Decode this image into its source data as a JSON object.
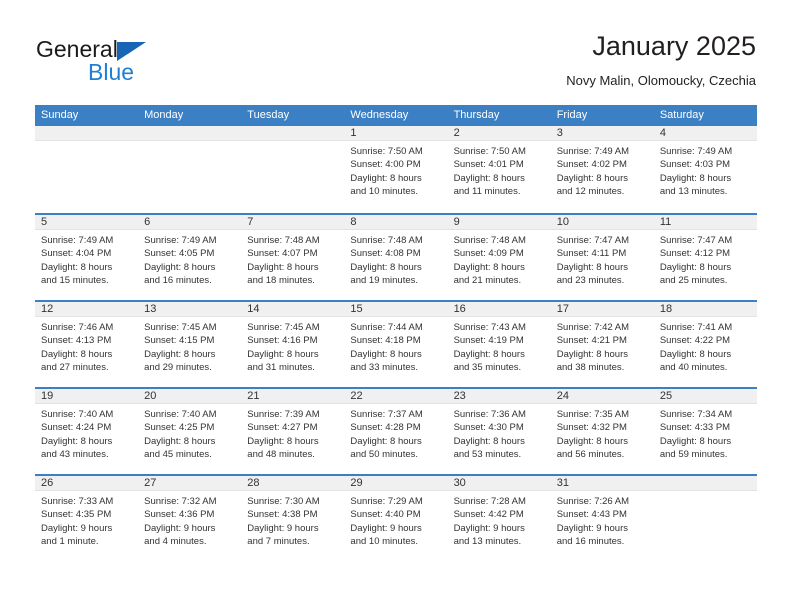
{
  "brand": {
    "name_part1": "General",
    "name_part2": "Blue",
    "triangle_icon": "brand-triangle-icon",
    "accent_color": "#1f7fd4"
  },
  "header": {
    "title": "January 2025",
    "subtitle": "Novy Malin, Olomoucky, Czechia"
  },
  "calendar": {
    "header_color": "#3b7fc4",
    "weekdays": [
      "Sunday",
      "Monday",
      "Tuesday",
      "Wednesday",
      "Thursday",
      "Friday",
      "Saturday"
    ],
    "weeks": [
      [
        {
          "day": "",
          "lines": []
        },
        {
          "day": "",
          "lines": []
        },
        {
          "day": "",
          "lines": []
        },
        {
          "day": "1",
          "lines": [
            "Sunrise: 7:50 AM",
            "Sunset: 4:00 PM",
            "Daylight: 8 hours",
            "and 10 minutes."
          ]
        },
        {
          "day": "2",
          "lines": [
            "Sunrise: 7:50 AM",
            "Sunset: 4:01 PM",
            "Daylight: 8 hours",
            "and 11 minutes."
          ]
        },
        {
          "day": "3",
          "lines": [
            "Sunrise: 7:49 AM",
            "Sunset: 4:02 PM",
            "Daylight: 8 hours",
            "and 12 minutes."
          ]
        },
        {
          "day": "4",
          "lines": [
            "Sunrise: 7:49 AM",
            "Sunset: 4:03 PM",
            "Daylight: 8 hours",
            "and 13 minutes."
          ]
        }
      ],
      [
        {
          "day": "5",
          "lines": [
            "Sunrise: 7:49 AM",
            "Sunset: 4:04 PM",
            "Daylight: 8 hours",
            "and 15 minutes."
          ]
        },
        {
          "day": "6",
          "lines": [
            "Sunrise: 7:49 AM",
            "Sunset: 4:05 PM",
            "Daylight: 8 hours",
            "and 16 minutes."
          ]
        },
        {
          "day": "7",
          "lines": [
            "Sunrise: 7:48 AM",
            "Sunset: 4:07 PM",
            "Daylight: 8 hours",
            "and 18 minutes."
          ]
        },
        {
          "day": "8",
          "lines": [
            "Sunrise: 7:48 AM",
            "Sunset: 4:08 PM",
            "Daylight: 8 hours",
            "and 19 minutes."
          ]
        },
        {
          "day": "9",
          "lines": [
            "Sunrise: 7:48 AM",
            "Sunset: 4:09 PM",
            "Daylight: 8 hours",
            "and 21 minutes."
          ]
        },
        {
          "day": "10",
          "lines": [
            "Sunrise: 7:47 AM",
            "Sunset: 4:11 PM",
            "Daylight: 8 hours",
            "and 23 minutes."
          ]
        },
        {
          "day": "11",
          "lines": [
            "Sunrise: 7:47 AM",
            "Sunset: 4:12 PM",
            "Daylight: 8 hours",
            "and 25 minutes."
          ]
        }
      ],
      [
        {
          "day": "12",
          "lines": [
            "Sunrise: 7:46 AM",
            "Sunset: 4:13 PM",
            "Daylight: 8 hours",
            "and 27 minutes."
          ]
        },
        {
          "day": "13",
          "lines": [
            "Sunrise: 7:45 AM",
            "Sunset: 4:15 PM",
            "Daylight: 8 hours",
            "and 29 minutes."
          ]
        },
        {
          "day": "14",
          "lines": [
            "Sunrise: 7:45 AM",
            "Sunset: 4:16 PM",
            "Daylight: 8 hours",
            "and 31 minutes."
          ]
        },
        {
          "day": "15",
          "lines": [
            "Sunrise: 7:44 AM",
            "Sunset: 4:18 PM",
            "Daylight: 8 hours",
            "and 33 minutes."
          ]
        },
        {
          "day": "16",
          "lines": [
            "Sunrise: 7:43 AM",
            "Sunset: 4:19 PM",
            "Daylight: 8 hours",
            "and 35 minutes."
          ]
        },
        {
          "day": "17",
          "lines": [
            "Sunrise: 7:42 AM",
            "Sunset: 4:21 PM",
            "Daylight: 8 hours",
            "and 38 minutes."
          ]
        },
        {
          "day": "18",
          "lines": [
            "Sunrise: 7:41 AM",
            "Sunset: 4:22 PM",
            "Daylight: 8 hours",
            "and 40 minutes."
          ]
        }
      ],
      [
        {
          "day": "19",
          "lines": [
            "Sunrise: 7:40 AM",
            "Sunset: 4:24 PM",
            "Daylight: 8 hours",
            "and 43 minutes."
          ]
        },
        {
          "day": "20",
          "lines": [
            "Sunrise: 7:40 AM",
            "Sunset: 4:25 PM",
            "Daylight: 8 hours",
            "and 45 minutes."
          ]
        },
        {
          "day": "21",
          "lines": [
            "Sunrise: 7:39 AM",
            "Sunset: 4:27 PM",
            "Daylight: 8 hours",
            "and 48 minutes."
          ]
        },
        {
          "day": "22",
          "lines": [
            "Sunrise: 7:37 AM",
            "Sunset: 4:28 PM",
            "Daylight: 8 hours",
            "and 50 minutes."
          ]
        },
        {
          "day": "23",
          "lines": [
            "Sunrise: 7:36 AM",
            "Sunset: 4:30 PM",
            "Daylight: 8 hours",
            "and 53 minutes."
          ]
        },
        {
          "day": "24",
          "lines": [
            "Sunrise: 7:35 AM",
            "Sunset: 4:32 PM",
            "Daylight: 8 hours",
            "and 56 minutes."
          ]
        },
        {
          "day": "25",
          "lines": [
            "Sunrise: 7:34 AM",
            "Sunset: 4:33 PM",
            "Daylight: 8 hours",
            "and 59 minutes."
          ]
        }
      ],
      [
        {
          "day": "26",
          "lines": [
            "Sunrise: 7:33 AM",
            "Sunset: 4:35 PM",
            "Daylight: 9 hours",
            "and 1 minute."
          ]
        },
        {
          "day": "27",
          "lines": [
            "Sunrise: 7:32 AM",
            "Sunset: 4:36 PM",
            "Daylight: 9 hours",
            "and 4 minutes."
          ]
        },
        {
          "day": "28",
          "lines": [
            "Sunrise: 7:30 AM",
            "Sunset: 4:38 PM",
            "Daylight: 9 hours",
            "and 7 minutes."
          ]
        },
        {
          "day": "29",
          "lines": [
            "Sunrise: 7:29 AM",
            "Sunset: 4:40 PM",
            "Daylight: 9 hours",
            "and 10 minutes."
          ]
        },
        {
          "day": "30",
          "lines": [
            "Sunrise: 7:28 AM",
            "Sunset: 4:42 PM",
            "Daylight: 9 hours",
            "and 13 minutes."
          ]
        },
        {
          "day": "31",
          "lines": [
            "Sunrise: 7:26 AM",
            "Sunset: 4:43 PM",
            "Daylight: 9 hours",
            "and 16 minutes."
          ]
        },
        {
          "day": "",
          "lines": []
        }
      ]
    ]
  }
}
